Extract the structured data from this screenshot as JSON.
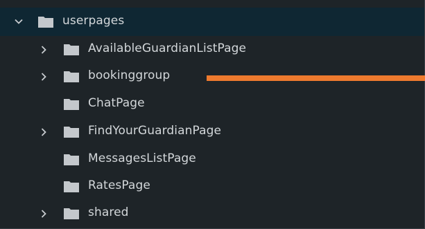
{
  "tree": {
    "root": {
      "label": "userpages",
      "expanded": true,
      "icon": "folder-icon"
    },
    "children": [
      {
        "label": "AvailableGuardianListPage",
        "expandable": true,
        "icon": "folder-icon"
      },
      {
        "label": "bookinggroup",
        "expandable": true,
        "icon": "folder-icon"
      },
      {
        "label": "ChatPage",
        "expandable": false,
        "icon": "folder-icon"
      },
      {
        "label": "FindYourGuardianPage",
        "expandable": true,
        "icon": "folder-icon"
      },
      {
        "label": "MessagesListPage",
        "expandable": false,
        "icon": "folder-icon"
      },
      {
        "label": "RatesPage",
        "expandable": false,
        "icon": "folder-icon"
      },
      {
        "label": "shared",
        "expandable": true,
        "icon": "folder-icon"
      }
    ]
  },
  "colors": {
    "background": "#1e2428",
    "selected_row": "#0f2733",
    "text": "#d3d7da",
    "folder": "#c4c8cc",
    "annotation": "#ee7a2e"
  }
}
